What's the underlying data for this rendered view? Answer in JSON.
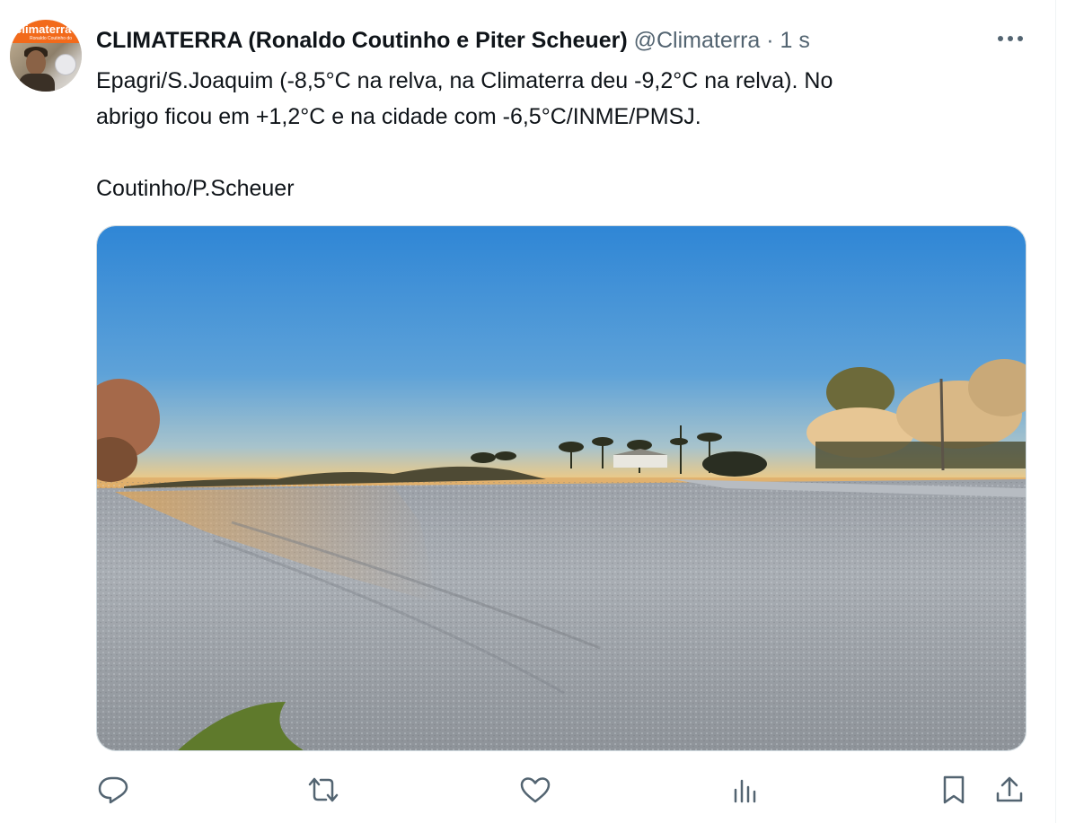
{
  "tweet": {
    "avatar": {
      "logo_text": "Climaterra",
      "logo_subtext": "Ronaldo Coutinho do"
    },
    "author_name": "CLIMATERRA (Ronaldo Coutinho e Piter Scheuer)",
    "handle": "@Climaterra",
    "separator": "·",
    "time": "1 s",
    "text_lines": [
      "Epagri/S.Joaquim (-8,5°C na relva, na Climaterra deu -9,2°C na relva). No",
      "abrigo ficou em +1,2°C e na cidade com -6,5°C/INME/PMSJ.",
      "",
      "Coutinho/P.Scheuer"
    ],
    "media": {
      "kind": "photo",
      "subject": "frost-covered field at sunrise"
    },
    "actions": {
      "reply_icon": "speech-bubble-icon",
      "retweet_icon": "retweet-icon",
      "like_icon": "heart-icon",
      "views_icon": "bar-chart-icon",
      "bookmark_icon": "bookmark-icon",
      "share_icon": "upload-icon"
    }
  },
  "colors": {
    "text_primary": "#0f1419",
    "text_secondary": "#536471",
    "icon": "#536471",
    "border": "#cfd9de",
    "avatar_brand": "#f26a1b"
  }
}
